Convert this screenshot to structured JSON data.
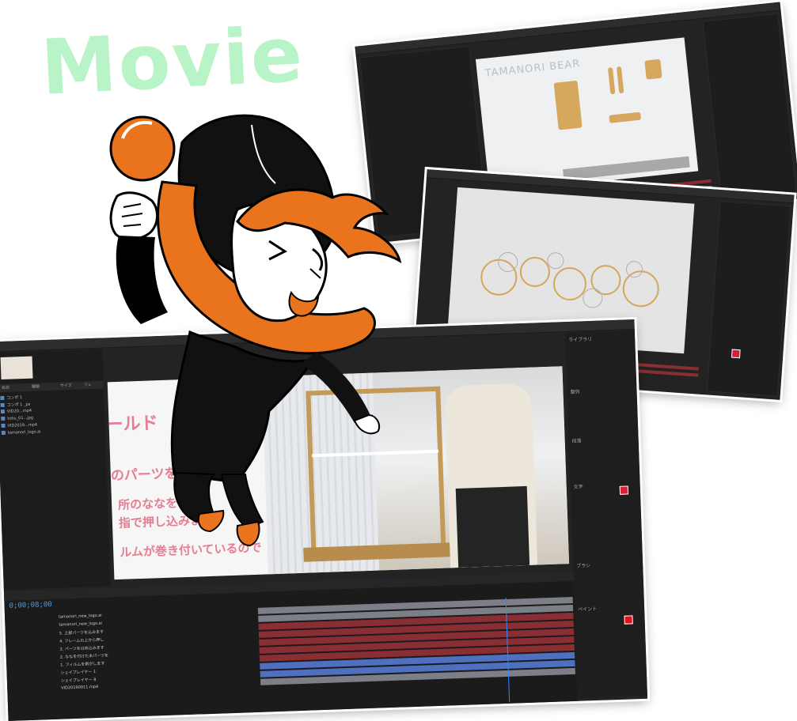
{
  "title": "Movie",
  "screenshot_1": {
    "brand": "TAMANORI BEAR"
  },
  "screenshot_3": {
    "timecode": "0;00;08;00",
    "project_header": [
      "名前",
      "種類",
      "サイズ",
      "フレ"
    ],
    "files": [
      "コンポ 1",
      "コンポ 1 _ps",
      "VID20...mp4",
      "tobu_01...jpg",
      "VID2019...mp4",
      "tamanori_logo.ai",
      "..."
    ],
    "subtitles": [
      "ールド",
      "のパーツを付",
      "所のななを付",
      "指で押し込みま",
      "ルムが巻き付いているので"
    ],
    "layers": [
      "tamanori_new_logo.ai",
      "tamanori_new_logo.ai",
      "5. 上部パーツを込みます",
      "4. フレームの上から押し",
      "3. パーツをはめ込みます",
      "2. ななを付けた木パーツを",
      "1. フィルムを剥がします",
      "シェイプレイヤー 1",
      "シェイプレイヤー 8",
      "VID20190911.mp4"
    ],
    "panel_labels": [
      "ライブラリ",
      "整列",
      "段落",
      "文字",
      "ブラシ",
      "ペイント"
    ]
  },
  "colors": {
    "title": "#b9f3c8",
    "accent_orange": "#e9741d",
    "timecode_blue": "#4d9de0",
    "subtitle_pink": "#e26981",
    "track_red": "#8a2e34",
    "track_blue": "#4f6fc0"
  },
  "icons": [
    "fist-icon",
    "mascot-character"
  ]
}
